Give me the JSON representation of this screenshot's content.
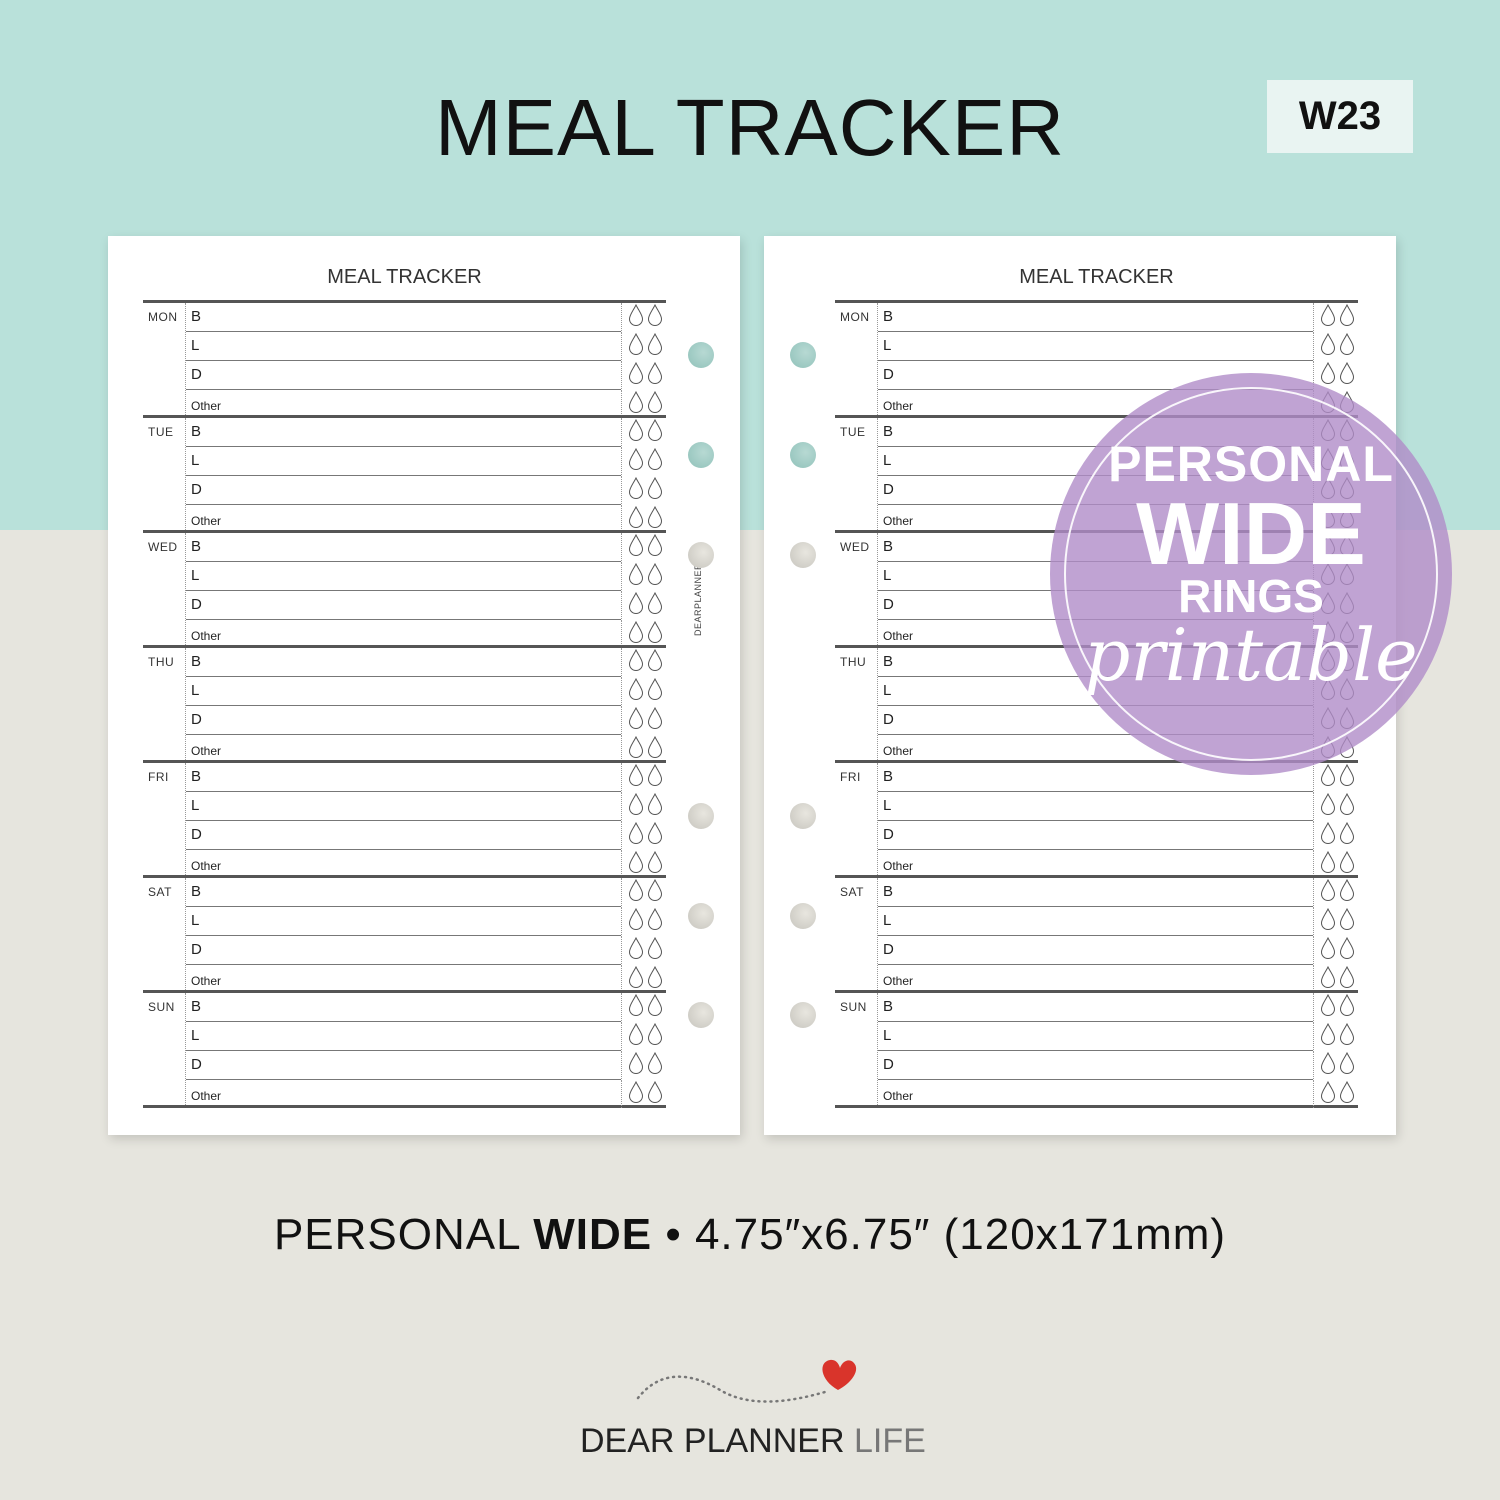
{
  "header": {
    "title": "MEAL TRACKER",
    "code": "W23",
    "band_color": "#b9e1da"
  },
  "pages": [
    {
      "id": "left",
      "title": "MEAL TRACKER",
      "brand_vertical": "DEARPLANNER ♡"
    },
    {
      "id": "right",
      "title": "MEAL TRACKER"
    }
  ],
  "days": [
    "MON",
    "TUE",
    "WED",
    "THU",
    "FRI",
    "SAT",
    "SUN"
  ],
  "meals": [
    "B",
    "L",
    "D",
    "Other"
  ],
  "water_drops_per_row": 2,
  "badge": {
    "line1": "PERSONAL",
    "line2": "WIDE",
    "line3": "RINGS",
    "line4": "printable",
    "color": "#b08cc8"
  },
  "size_info": {
    "prefix": "PERSONAL",
    "bold": "WIDE",
    "suffix": "• 4.75″x6.75″ (120x171mm)"
  },
  "logo": {
    "main": "DEAR PLANNER",
    "light": "LIFE",
    "heart_color": "#d9342b"
  }
}
